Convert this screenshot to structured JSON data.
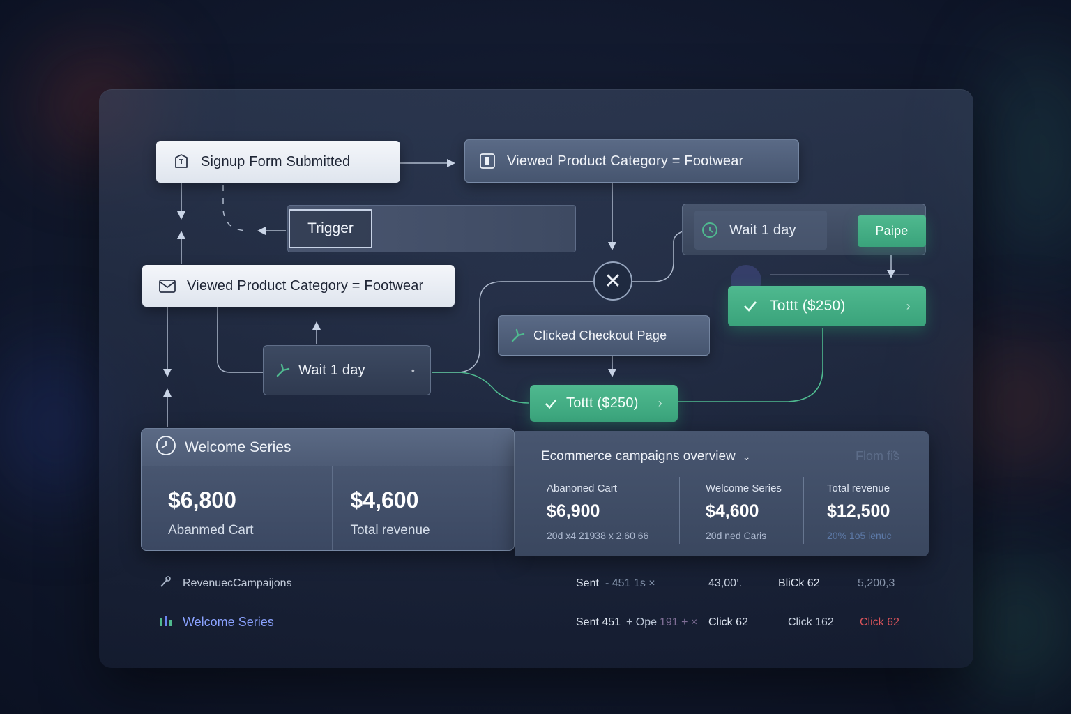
{
  "flow": {
    "signup": "Signup Form Submitted",
    "viewed_top": "Viewed Product Category = Footwear",
    "trigger": "Trigger",
    "wait_right": "Wait 1 day",
    "pause_button": "Paipe",
    "viewed_left": "Viewed Product Category = Footwear",
    "tott_right": "Tottt  ($250)",
    "clicked_checkout": "Clicked Checkout Page",
    "wait_left": "Wait 1 day",
    "tott_center": "Tottt ($250)",
    "close_symbol": "✕"
  },
  "welcome_card": {
    "title": "Welcome Series",
    "stats": [
      {
        "value": "$6,800",
        "label": "Abanmed Cart"
      },
      {
        "value": "$4,600",
        "label": "Total revenue"
      }
    ]
  },
  "overview": {
    "title": "Ecommerce campaigns overview",
    "right_label": "Flom ﬁ̃s",
    "columns": [
      {
        "label": "Abanoned Cart",
        "value": "$6,900",
        "sub": "20d x4 21938  x  2.60 66"
      },
      {
        "label": "Welcome Series",
        "value": "$4,600",
        "sub": "20d ned Caris"
      },
      {
        "label": "Total revenue",
        "value": "$12,500",
        "sub": "20% 1o5 ienuc"
      }
    ]
  },
  "table": {
    "rows": [
      {
        "name": "RevenuecCampaijons",
        "sent": "Sent",
        "sent_extra": "- 451 1s ×",
        "c2": "43,00’.",
        "c3": "BliCk 62",
        "c4": "5,200,3"
      },
      {
        "name": "Welcome Series",
        "sent": "Sent  451",
        "sent_extra": "+ Ope",
        "sent_extra2": "191 + ×",
        "c2": "Click  62",
        "c3": "Click  162",
        "c4": "Click  62"
      }
    ]
  },
  "colors": {
    "green": "#43ad84",
    "red": "#d9535a",
    "link": "#8aa2ff"
  }
}
